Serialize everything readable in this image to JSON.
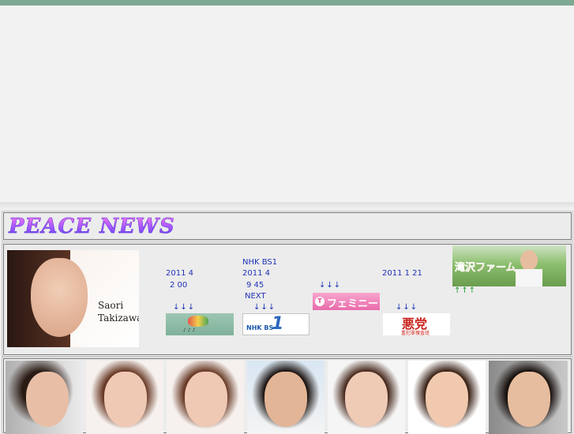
{
  "colors": {
    "topbar": "#7fa892",
    "link": "#1f33b5",
    "arrow_green": "#1e9a2c"
  },
  "header": {
    "title": "PEACE NEWS"
  },
  "portrait": {
    "name_line1": "Saori",
    "name_line2": "Takizawa"
  },
  "items": [
    {
      "date": "2011 4",
      "time": "2 00",
      "arrows": "↓↓↓",
      "icon": "children-tv-logo"
    },
    {
      "pre": "NHK BS1",
      "date": "2011 4",
      "time": "9 45",
      "next": "NEXT",
      "arrows": "↓↓↓",
      "icon": "bs1-channel-logo",
      "logo_sub": "NHK BS",
      "logo_num": "1"
    },
    {
      "arrows": "↓↓↓",
      "icon": "feminina-logo",
      "logo_text": "フェミニーナ",
      "logo_mark": "T"
    },
    {
      "date": "2011 1 21",
      "arrows": "↓↓↓",
      "icon": "akutou-logo",
      "logo_text": "悪党",
      "logo_sub": "重犯罪捜査班"
    }
  ],
  "farm": {
    "text": "滝沢ファーム",
    "arrows": "↑↑↑"
  },
  "gallery": {
    "count": 7
  }
}
